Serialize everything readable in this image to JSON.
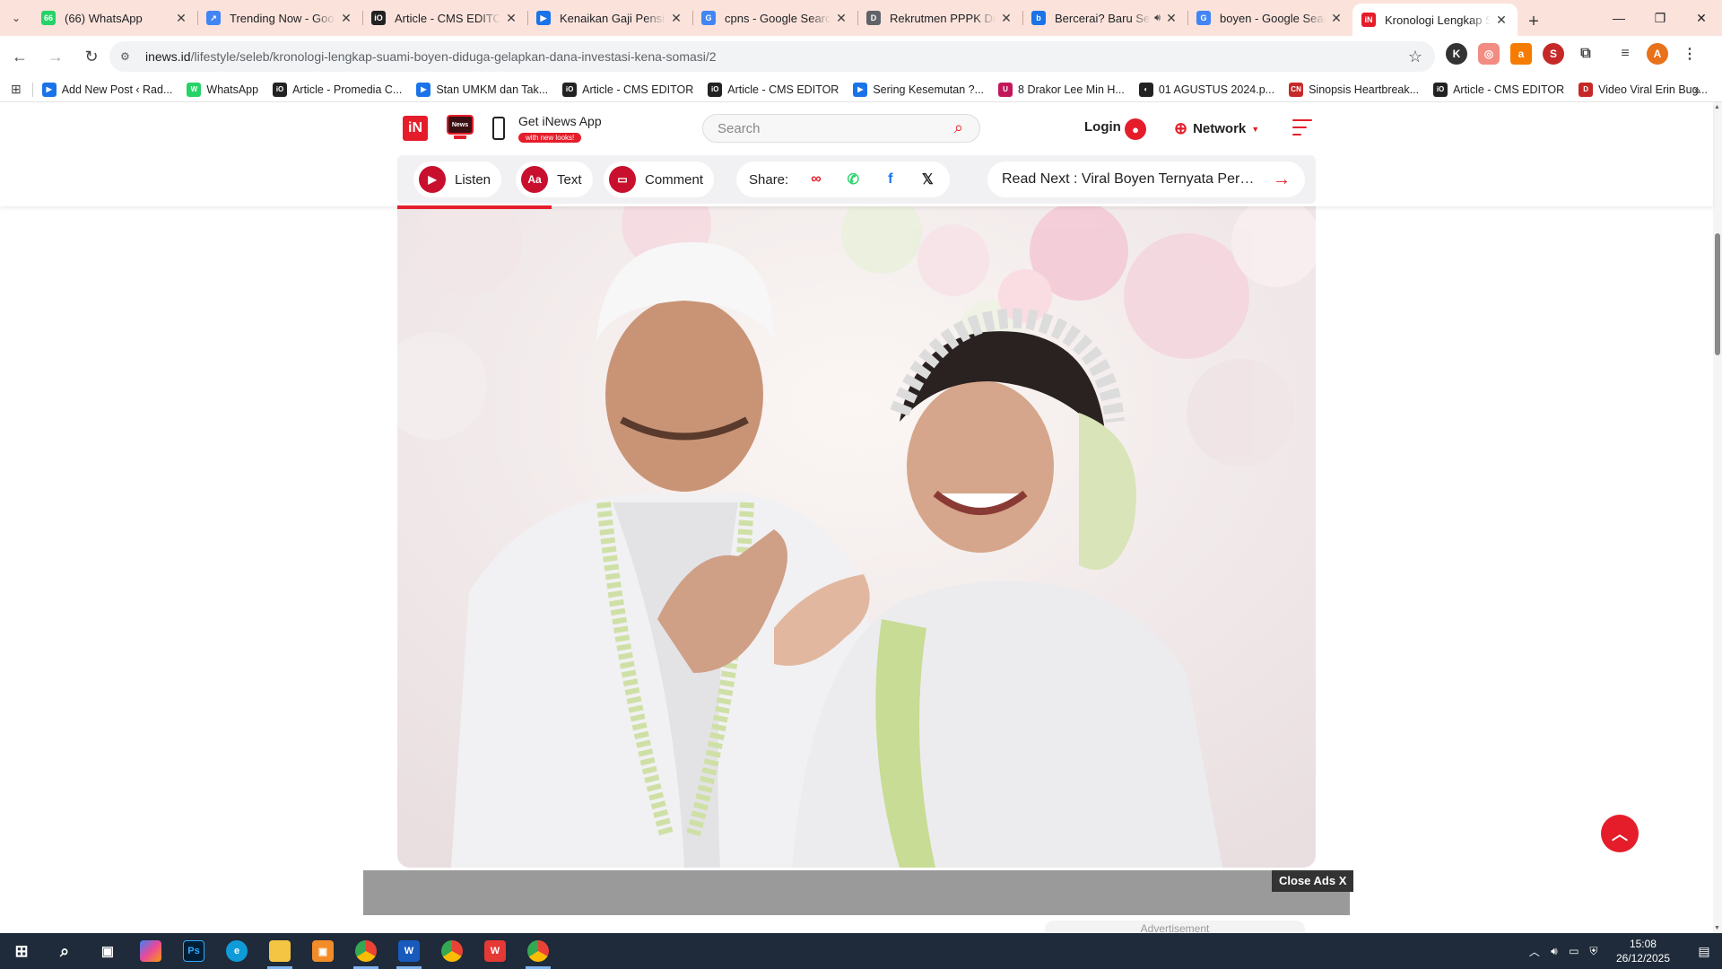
{
  "browser": {
    "tabs": [
      {
        "title": "(66) WhatsApp",
        "favicon": "whatsapp-icon",
        "favicon_text": "66",
        "favicon_color": "#25d366"
      },
      {
        "title": "Trending Now - Google Trends",
        "favicon": "trends-icon",
        "favicon_text": "↗",
        "favicon_color": "#4285f4"
      },
      {
        "title": "Article - CMS EDITOR",
        "favicon": "cms-icon",
        "favicon_text": "iO",
        "favicon_color": "#222222"
      },
      {
        "title": "Kenaikan Gaji Pensiunan",
        "favicon": "bookmark-blue-icon",
        "favicon_text": "▶",
        "favicon_color": "#1a73e8"
      },
      {
        "title": "cpns - Google Search",
        "favicon": "google-icon",
        "favicon_text": "G",
        "favicon_color": "#4285f4"
      },
      {
        "title": "Rekrutmen PPPK Dibuka",
        "favicon": "doc-icon",
        "favicon_text": "D",
        "favicon_color": "#5f6368"
      },
      {
        "title": "Bercerai? Baru Sebulan",
        "favicon": "bing-icon",
        "favicon_text": "b",
        "favicon_color": "#1a73e8",
        "audio": true
      },
      {
        "title": "boyen - Google Search",
        "favicon": "google-icon",
        "favicon_text": "G",
        "favicon_color": "#4285f4"
      },
      {
        "title": "Kronologi Lengkap Suami Boyen",
        "favicon": "inews-icon",
        "favicon_text": "iN",
        "favicon_color": "#e51d2a",
        "active": true
      }
    ],
    "url_host": "inews.id",
    "url_path": "/lifestyle/seleb/kronologi-lengkap-suami-boyen-diduga-gelapkan-dana-investasi-kena-somasi/2",
    "bookmarks": [
      {
        "label": "Add New Post ‹ Rad...",
        "color": "#1a73e8",
        "glyph": "▶"
      },
      {
        "label": "WhatsApp",
        "color": "#25d366",
        "glyph": "W"
      },
      {
        "label": "Article - Promedia C...",
        "color": "#222222",
        "glyph": "iO"
      },
      {
        "label": "Stan UMKM dan Tak...",
        "color": "#1a73e8",
        "glyph": "▶"
      },
      {
        "label": "Article - CMS EDITOR",
        "color": "#222222",
        "glyph": "iO"
      },
      {
        "label": "Article - CMS EDITOR",
        "color": "#222222",
        "glyph": "iO"
      },
      {
        "label": "Sering Kesemutan ?...",
        "color": "#1a73e8",
        "glyph": "▶"
      },
      {
        "label": "8 Drakor Lee Min H...",
        "color": "#c2185b",
        "glyph": "U"
      },
      {
        "label": "01 AGUSTUS 2024.p...",
        "color": "#222222",
        "glyph": "◐"
      },
      {
        "label": "Sinopsis Heartbreak...",
        "color": "#c62828",
        "glyph": "CN"
      },
      {
        "label": "Article - CMS EDITOR",
        "color": "#222222",
        "glyph": "iO"
      },
      {
        "label": "Video Viral Erin Bug...",
        "color": "#c62828",
        "glyph": "D"
      }
    ]
  },
  "site": {
    "logo_text": "iN",
    "tv_text": "News",
    "get_app": "Get iNews App",
    "get_app_badge": "with new looks!",
    "search_placeholder": "Search",
    "login": "Login",
    "network": "Network",
    "actions": {
      "listen": "Listen",
      "text": "Text",
      "text_icon": "Aa",
      "comment": "Comment",
      "share": "Share:",
      "read_next": "Read Next : Viral Boyen Ternyata Pernah Dilaporkan"
    },
    "close_ads": "Close Ads X",
    "advertisement": "Advertisement"
  },
  "taskbar": {
    "time": "15:08",
    "date": "26/12/2025"
  },
  "colors": {
    "brand": "#e51d2a",
    "tabstrip": "#fbe3dc",
    "taskbar": "#1f2b3a"
  }
}
